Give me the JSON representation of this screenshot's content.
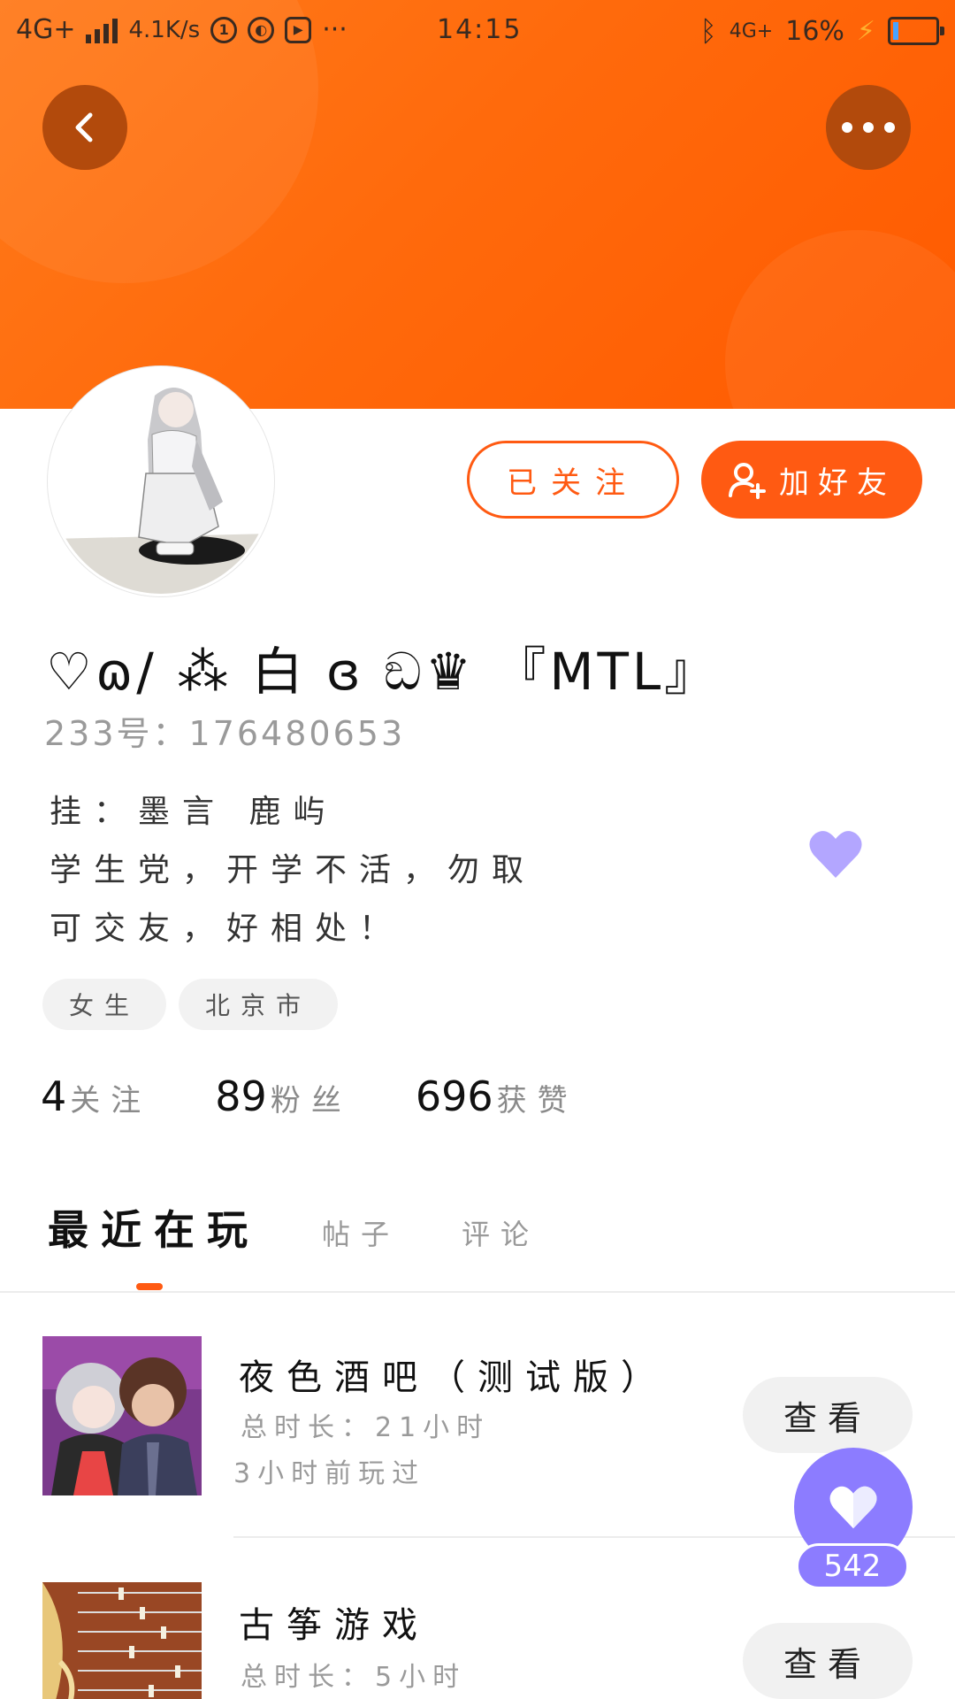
{
  "status_bar": {
    "network": "4G+",
    "speed": "4.1K/s",
    "more": "···",
    "time": "14:15",
    "network_right": "4G+",
    "battery": "16%"
  },
  "colors": {
    "brand": "#ff5a12",
    "accent": "#8c7cff"
  },
  "header": {
    "back_icon": "back-arrow-icon",
    "more_icon": "more-dots-icon"
  },
  "profile": {
    "followed_label": "已关注",
    "add_friend_label": "加好友",
    "username": "♡ɷ/ ⁂ 白 ɞ ඞ♛ 『MTL』",
    "uid": "233号：176480653",
    "bio": [
      "挂：墨言    鹿屿",
      "学生党，开学不活，勿取",
      "可交友，好相处！"
    ],
    "tags": [
      "女生",
      "北京市"
    ],
    "stats": [
      {
        "num": "4",
        "label": "关注"
      },
      {
        "num": "89",
        "label": "粉丝"
      },
      {
        "num": "696",
        "label": "获赞"
      }
    ]
  },
  "tabs": [
    "最近在玩",
    "帖子",
    "评论"
  ],
  "games": [
    {
      "title": "夜色酒吧（测试版）",
      "duration": "总时长：21小时",
      "last_played": "3小时前玩过",
      "view_label": "查看"
    },
    {
      "title": "古筝游戏",
      "duration": "总时长：5小时",
      "view_label": "查看"
    }
  ],
  "like_fab": {
    "count": "542"
  }
}
